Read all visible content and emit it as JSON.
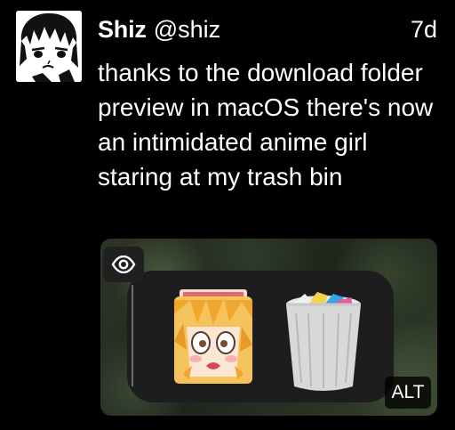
{
  "post": {
    "display_name": "Shiz",
    "handle": "@shiz",
    "time": "7d",
    "text": "thanks to the download folder preview in macOS there's now an intimidated anime girl staring at my trash bin"
  },
  "media": {
    "alt_label": "ALT",
    "eye_icon": "eye-icon"
  },
  "colors": {
    "background": "#000000",
    "text": "#ffffff",
    "panel": "#1d1d1d"
  }
}
